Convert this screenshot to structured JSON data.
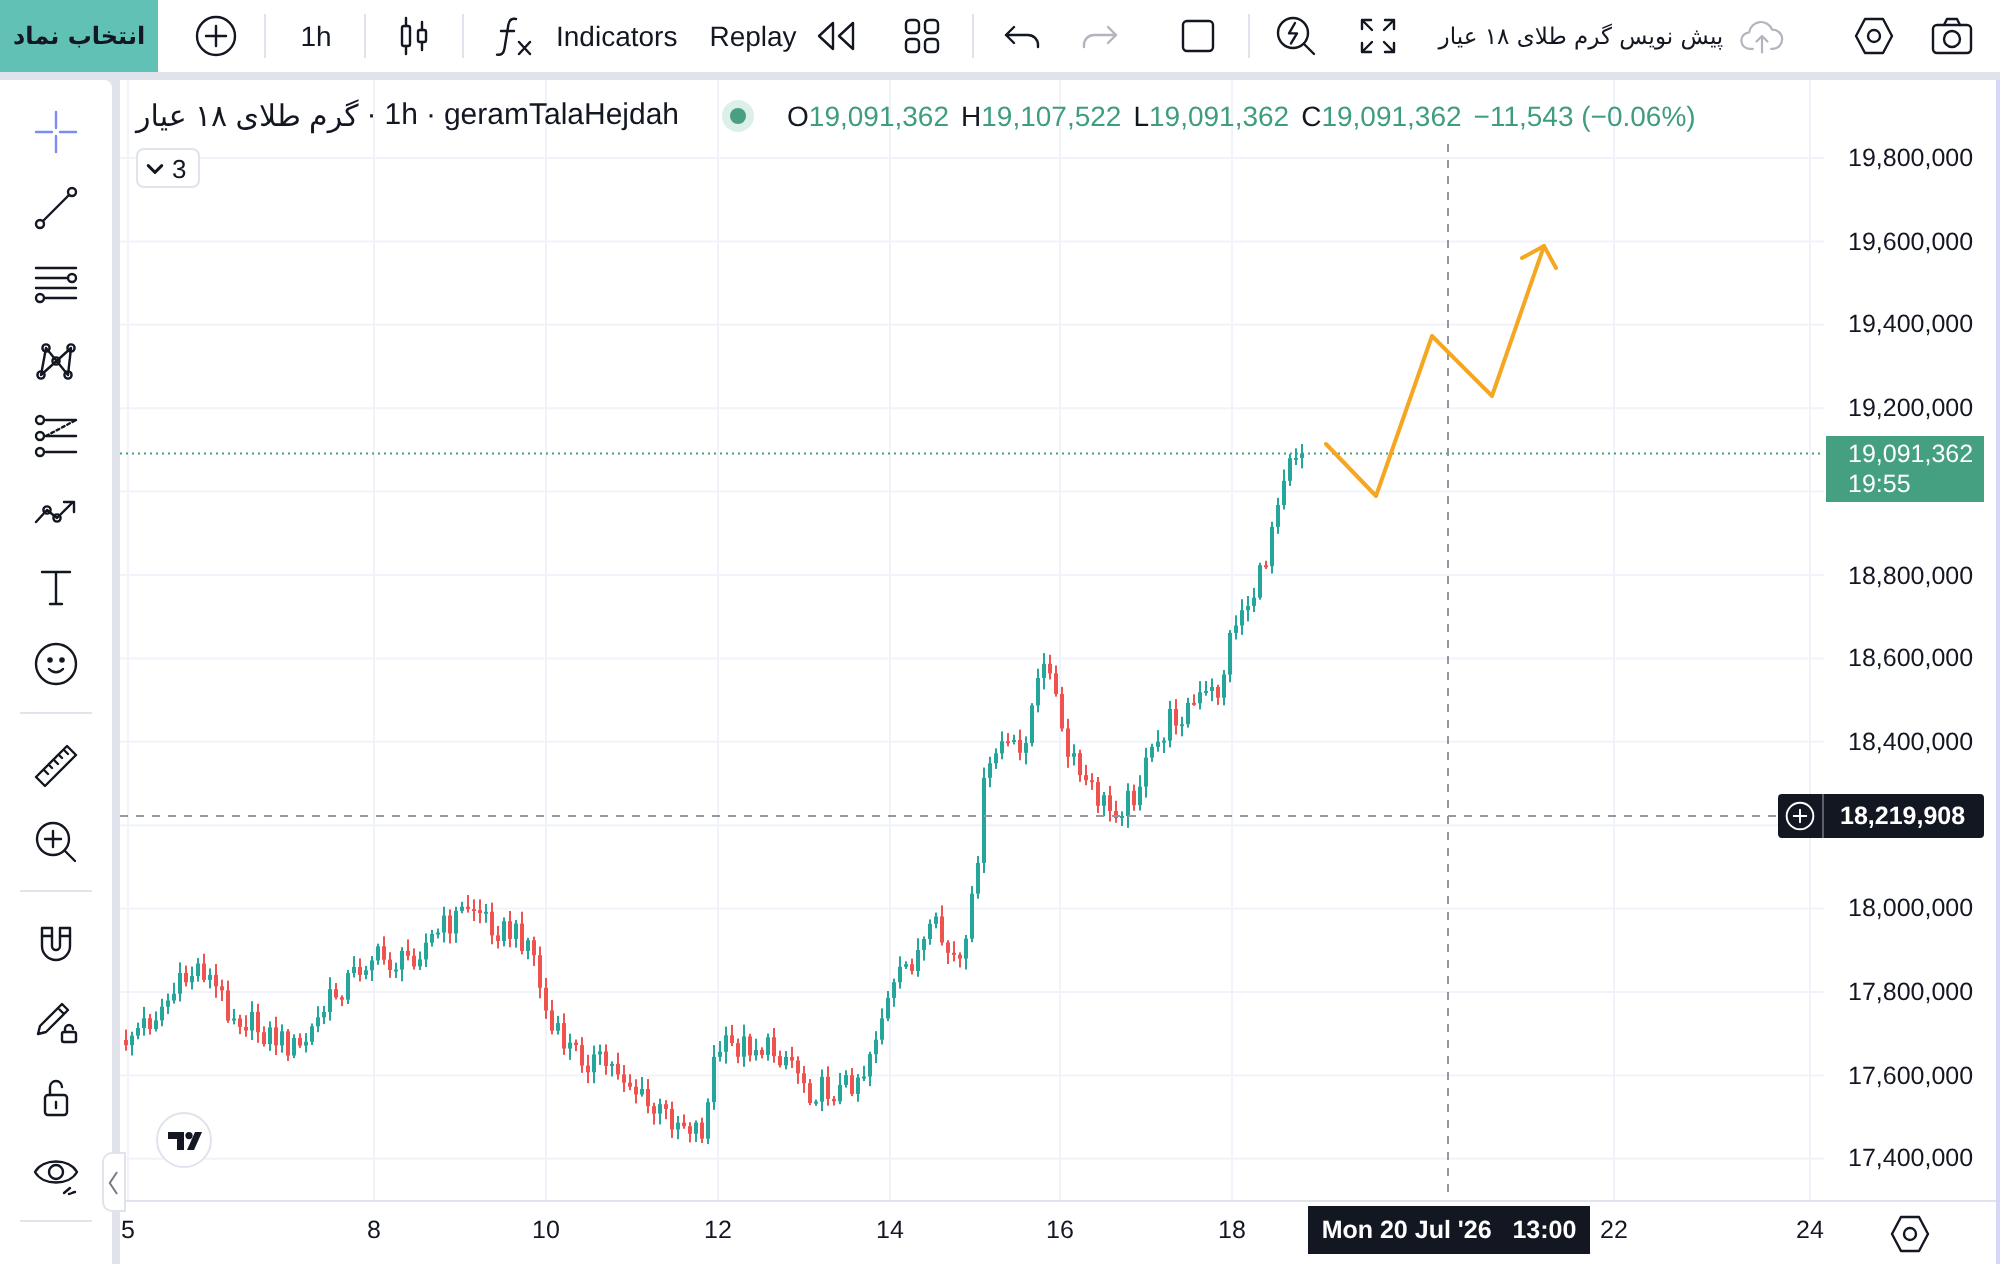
{
  "top_toolbar": {
    "symbol_button": "انتخاب نماد",
    "interval": "1h",
    "indicators_button": "Indicators",
    "replay_button": "Replay",
    "history": [
      {
        "kind": "undo",
        "disabled": false
      },
      {
        "kind": "redo",
        "disabled": true
      }
    ],
    "layout_name": "پیش نویس گرم طلای ۱۸ عیار"
  },
  "drawing_toolbar": {
    "groups": [
      [
        {
          "kind": "crosshair",
          "selected": true
        },
        {
          "kind": "trend-line",
          "selected": false
        },
        {
          "kind": "horizontal-lines",
          "selected": false
        },
        {
          "kind": "pattern",
          "selected": false
        },
        {
          "kind": "projection",
          "selected": false
        },
        {
          "kind": "path",
          "selected": false
        },
        {
          "kind": "text",
          "selected": false
        },
        {
          "kind": "emoji",
          "selected": false
        }
      ],
      [
        {
          "kind": "ruler",
          "selected": false
        },
        {
          "kind": "zoom",
          "selected": false
        }
      ],
      [
        {
          "kind": "magnet",
          "selected": false
        },
        {
          "kind": "lock-drawings",
          "selected": false
        },
        {
          "kind": "lock",
          "selected": false
        },
        {
          "kind": "eye",
          "selected": false
        }
      ]
    ]
  },
  "legend": {
    "title_parts": [
      "گرم طلای ۱۸ عیار",
      "·",
      "1h",
      "·",
      "geramTalaHejdah"
    ],
    "market_open": true,
    "ohlc": [
      {
        "label": "O",
        "value": "19,091,362"
      },
      {
        "label": "H",
        "value": "19,107,522"
      },
      {
        "label": "L",
        "value": "19,091,362"
      },
      {
        "label": "C",
        "value": "19,091,362"
      }
    ],
    "change": "−11,543 (−0.06%)",
    "indicators_count": "3"
  },
  "price_axis": {
    "labels": [
      "19,800,000",
      "19,600,000",
      "19,400,000",
      "19,200,000",
      "18,800,000",
      "18,600,000",
      "18,400,000",
      "18,000,000",
      "17,800,000",
      "17,600,000",
      "17,400,000"
    ],
    "last_price": "19,091,362",
    "countdown": "19:55",
    "crosshair_price": "18,219,908"
  },
  "time_axis": {
    "labels": [
      "5",
      "8",
      "10",
      "12",
      "14",
      "16",
      "18",
      "22",
      "24"
    ],
    "crosshair_time": "Mon 20 Jul '26   13:00"
  }
}
